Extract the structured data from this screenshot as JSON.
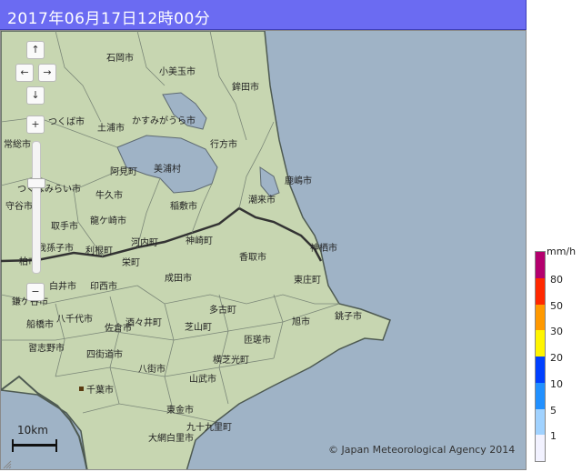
{
  "header": {
    "title": "2017年06月17日12時00分"
  },
  "controls": {
    "pan_up": "↑",
    "pan_left": "←",
    "pan_right": "→",
    "pan_down": "↓",
    "zoom_in": "+",
    "zoom_out": "−"
  },
  "scale": {
    "label": "10km"
  },
  "copyright": "© Japan Meteorological Agency 2014",
  "legend": {
    "unit": "mm/h",
    "levels": [
      {
        "label": "80",
        "color": "#b4006e"
      },
      {
        "label": "50",
        "color": "#ff2800"
      },
      {
        "label": "30",
        "color": "#ff9900"
      },
      {
        "label": "20",
        "color": "#fff500"
      },
      {
        "label": "10",
        "color": "#0040ff"
      },
      {
        "label": "5",
        "color": "#2190ff"
      },
      {
        "label": "1",
        "color": "#a0d2ff"
      },
      {
        "label": "",
        "color": "#f2f2ff"
      }
    ]
  },
  "places": [
    "石岡市",
    "小美玉市",
    "鉾田市",
    "つくば市",
    "土浦市",
    "かすみがうら市",
    "常総市",
    "行方市",
    "阿見町",
    "美浦村",
    "鹿嶋市",
    "つくばみらい市",
    "牛久市",
    "守谷市",
    "龍ケ崎市",
    "稲敷市",
    "潮来市",
    "取手市",
    "我孫子市",
    "利根町",
    "河内町",
    "神崎町",
    "神栖市",
    "柏市",
    "栄町",
    "香取市",
    "成田市",
    "東庄町",
    "白井市",
    "印西市",
    "鎌ケ谷市",
    "船橋市",
    "八千代市",
    "佐倉市",
    "酒々井町",
    "芝山町",
    "多古町",
    "旭市",
    "銚子市",
    "習志野市",
    "四街道市",
    "匝瑳市",
    "横芝光町",
    "八街市",
    "山武市",
    "千葉市",
    "東金市",
    "九十九里町",
    "大網白里市"
  ]
}
